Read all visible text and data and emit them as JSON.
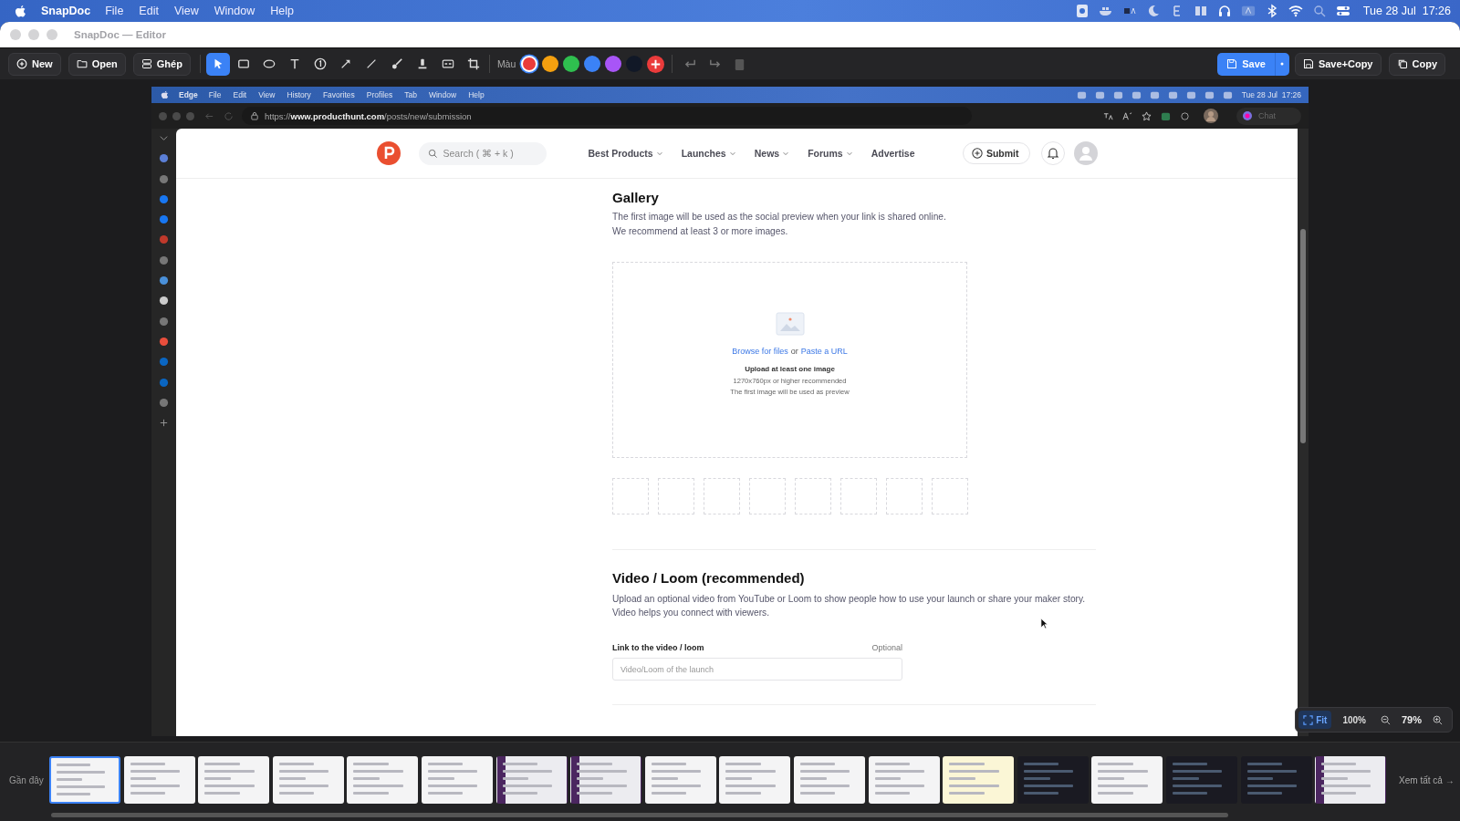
{
  "menubar": {
    "app": "SnapDoc",
    "menus": [
      "File",
      "Edit",
      "View",
      "Window",
      "Help"
    ],
    "clock": "Tue 28 Jul  17:26"
  },
  "window": {
    "title": "SnapDoc — Editor"
  },
  "toolbar": {
    "left_buttons": [
      {
        "label": "New",
        "kind": "new"
      },
      {
        "label": "Open",
        "kind": "open"
      },
      {
        "label": "Ghép",
        "kind": "merge"
      }
    ],
    "tools": [
      {
        "kind": "select",
        "selected": true
      },
      {
        "kind": "rect",
        "selected": false
      },
      {
        "kind": "ellipse",
        "selected": false
      },
      {
        "kind": "text",
        "selected": false
      },
      {
        "kind": "number",
        "selected": false
      },
      {
        "kind": "arrow",
        "selected": false
      },
      {
        "kind": "line",
        "selected": false
      },
      {
        "kind": "brush",
        "selected": false
      },
      {
        "kind": "marker",
        "selected": false
      },
      {
        "kind": "blur",
        "selected": false
      },
      {
        "kind": "crop",
        "selected": false
      }
    ],
    "color_label": "Màu",
    "colors": [
      {
        "color": "#ea3b3b",
        "selected": true
      },
      {
        "color": "#f5a00f",
        "selected": false
      },
      {
        "color": "#2fbf4f",
        "selected": false
      },
      {
        "color": "#3b82f6",
        "selected": false
      },
      {
        "color": "#a855f7",
        "selected": false
      },
      {
        "color": "#111827",
        "selected": false
      }
    ],
    "save": "Save",
    "save_copy": "Save+Copy",
    "copy": "Copy"
  },
  "screenshot": {
    "menubar": {
      "app": "Edge",
      "menus": [
        "File",
        "Edit",
        "View",
        "History",
        "Favorites",
        "Profiles",
        "Tab",
        "Window",
        "Help"
      ],
      "clock": "Tue 28 Jul  17:26"
    },
    "browser": {
      "url": "https://**www.producthunt.com**/posts/new/submission",
      "chat": "Chat"
    },
    "page": {
      "search": {
        "placeholder": "Search ( ⌘ + k )"
      },
      "nav": [
        {
          "label": "Best Products",
          "dropdown": true
        },
        {
          "label": "Launches",
          "dropdown": true
        },
        {
          "label": "News",
          "dropdown": true
        },
        {
          "label": "Forums",
          "dropdown": true
        },
        {
          "label": "Advertise",
          "dropdown": false
        }
      ],
      "submit": "Submit",
      "gallery": {
        "title": "Gallery",
        "description": [
          "The first image will be used as the social preview when your link is shared online.",
          "We recommend at least 3 or more images."
        ],
        "browse": "Browse for files",
        "or": "or",
        "paste": "Paste a URL",
        "hint_title": "Upload at least one image",
        "hints": [
          "1270x760px or higher recommended",
          "The first image will be used as preview"
        ],
        "slots": [
          {
            "filled": false
          },
          {
            "filled": false
          },
          {
            "filled": false
          },
          {
            "filled": false
          },
          {
            "filled": false
          },
          {
            "filled": false
          },
          {
            "filled": false
          },
          {
            "filled": false
          }
        ]
      },
      "video": {
        "title": "Video / Loom (recommended)",
        "description": "Upload an optional video from YouTube or Loom to show people how to use your launch or share your maker story. Video helps you connect with viewers.",
        "field_label": "Link to the video / loom",
        "optional": "Optional",
        "placeholder": "Video/Loom of the launch"
      }
    }
  },
  "zoom": {
    "fit": "Fit",
    "actual": "100%",
    "level_text": "79%"
  },
  "recent": {
    "label": "Gần đây",
    "see_all": "Xem tất cả →",
    "thumbnails": [
      {
        "kind": "light",
        "selected": true
      },
      {
        "kind": "light",
        "selected": false
      },
      {
        "kind": "light",
        "selected": false
      },
      {
        "kind": "light",
        "selected": false
      },
      {
        "kind": "light",
        "selected": false
      },
      {
        "kind": "light",
        "selected": false
      },
      {
        "kind": "purple",
        "selected": false
      },
      {
        "kind": "purple",
        "selected": false
      },
      {
        "kind": "light",
        "selected": false
      },
      {
        "kind": "light",
        "selected": false
      },
      {
        "kind": "light",
        "selected": false
      },
      {
        "kind": "light",
        "selected": false
      },
      {
        "kind": "yellow",
        "selected": false
      },
      {
        "kind": "dark",
        "selected": false
      },
      {
        "kind": "light",
        "selected": false
      },
      {
        "kind": "dark",
        "selected": false
      },
      {
        "kind": "dark",
        "selected": false
      },
      {
        "kind": "purple",
        "selected": false
      }
    ]
  }
}
